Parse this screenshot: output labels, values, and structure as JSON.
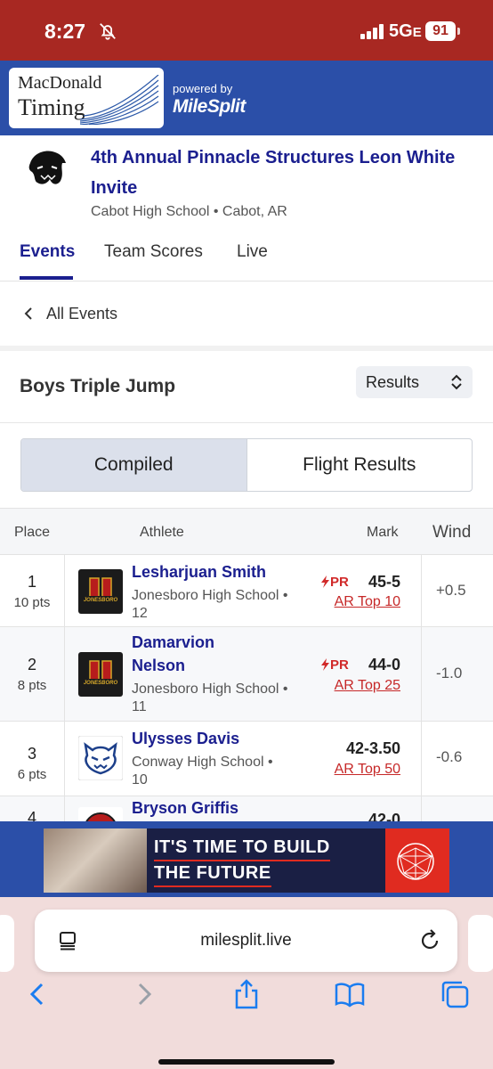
{
  "status_bar": {
    "time": "8:27",
    "network": "5G",
    "network_suffix": "E",
    "battery": "91"
  },
  "brand": {
    "logo_line1": "MacDonald",
    "logo_line2": "Timing",
    "powered_by": "powered by",
    "partner": "MileSplit"
  },
  "meet": {
    "title": "4th Annual Pinnacle Structures Leon White Invite",
    "subtitle": "Cabot High School • Cabot, AR"
  },
  "tabs": [
    {
      "label": "Events",
      "active": true
    },
    {
      "label": "Team Scores",
      "active": false
    },
    {
      "label": "Live",
      "active": false
    }
  ],
  "back_link": "All Events",
  "event": {
    "name": "Boys Triple Jump",
    "view_select": "Results",
    "segments": [
      {
        "label": "Compiled",
        "active": true
      },
      {
        "label": "Flight Results",
        "active": false
      }
    ]
  },
  "table": {
    "headers": {
      "place": "Place",
      "athlete": "Athlete",
      "mark": "Mark",
      "wind": "Wind"
    },
    "rows": [
      {
        "place": "1",
        "pts": "10 pts",
        "name": "Lesharjuan Smith",
        "school": "Jonesboro High School • 12",
        "pr": "PR",
        "mark": "45-5",
        "rank": "AR Top 10",
        "wind": "+0.5",
        "team_logo": "jonesboro-logo"
      },
      {
        "place": "2",
        "pts": "8 pts",
        "name": "Damarvion Nelson",
        "school": "Jonesboro High School • 11",
        "pr": "PR",
        "mark": "44-0",
        "rank": "AR Top 25",
        "wind": "-1.0",
        "team_logo": "jonesboro-logo"
      },
      {
        "place": "3",
        "pts": "6 pts",
        "name": "Ulysses Davis",
        "school": "Conway High School • 10",
        "pr": "",
        "mark": "42-3.50",
        "rank": "AR Top 50",
        "wind": "-0.6",
        "team_logo": "conway-wampus-logo"
      },
      {
        "place": "4",
        "pts": "",
        "name": "Bryson Griffis",
        "school": "",
        "pr": "",
        "mark": "42-0",
        "rank": "",
        "wind": "",
        "team_logo": "school-logo"
      }
    ]
  },
  "ad": {
    "headline_line1": "IT'S TIME TO BUILD",
    "headline_line2": "THE FUTURE"
  },
  "browser": {
    "url": "milesplit.live"
  },
  "colors": {
    "status_red": "#a82822",
    "brand_blue": "#2b4fa8",
    "link_navy": "#1b1f8f",
    "rank_red": "#c62828"
  },
  "icons": [
    "bell-slash-icon",
    "signal-icon",
    "battery-icon",
    "chevron-left-icon",
    "updown-chevron-icon",
    "bolt-icon",
    "page-icon",
    "reload-icon",
    "back-icon",
    "forward-icon",
    "share-icon",
    "bookmarks-icon",
    "tabs-icon"
  ]
}
